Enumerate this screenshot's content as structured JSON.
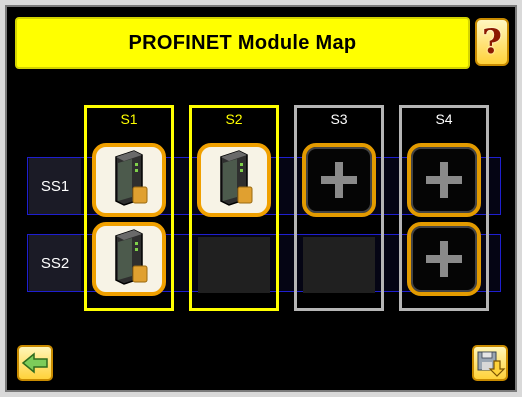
{
  "header": {
    "title": "PROFINET Module Map",
    "help_glyph": "?"
  },
  "slots": [
    {
      "label": "S1",
      "state": "active"
    },
    {
      "label": "S2",
      "state": "active"
    },
    {
      "label": "S3",
      "state": "available"
    },
    {
      "label": "S4",
      "state": "available"
    }
  ],
  "subslots": [
    {
      "label": "SS1"
    },
    {
      "label": "SS2"
    }
  ],
  "grid": [
    [
      "module",
      "module",
      "add",
      "add"
    ],
    [
      "module",
      "empty",
      "empty",
      "add"
    ]
  ],
  "colors": {
    "title_bg": "#ffff00",
    "active_slot": "#ffff00",
    "available_slot": "#b5b5b5",
    "tile_border": "#f0a000",
    "row_border": "#1f1fd0"
  },
  "icons": {
    "help": "help-icon",
    "back": "back-arrow-icon",
    "save": "save-icon",
    "module": "profinet-module-icon",
    "add": "plus-icon"
  }
}
